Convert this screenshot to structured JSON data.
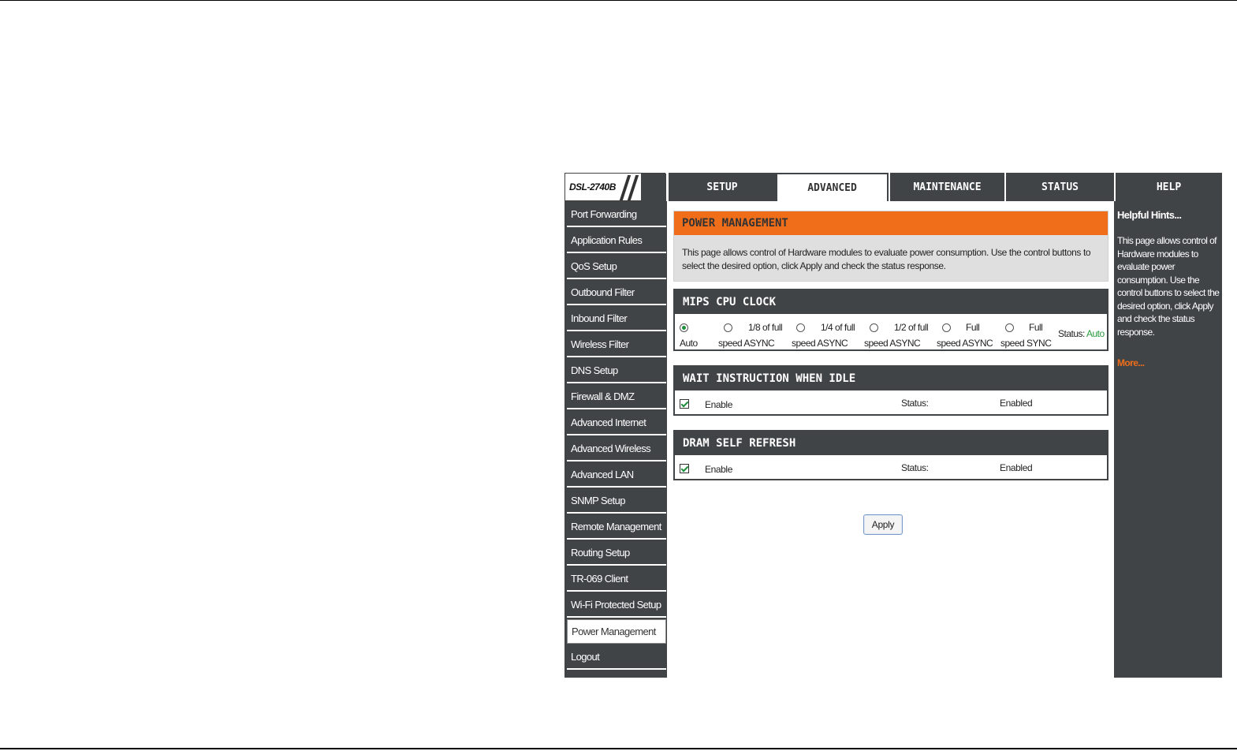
{
  "header": {
    "logo": "DSL-2740B",
    "tabs": [
      {
        "label": "SETUP",
        "active": false
      },
      {
        "label": "ADVANCED",
        "active": true
      },
      {
        "label": "MAINTENANCE",
        "active": false
      },
      {
        "label": "STATUS",
        "active": false
      },
      {
        "label": "HELP",
        "active": false
      }
    ]
  },
  "sidebar": {
    "items": [
      "Port Forwarding",
      "Application Rules",
      "QoS Setup",
      "Outbound Filter",
      "Inbound Filter",
      "Wireless Filter",
      "DNS Setup",
      "Firewall & DMZ",
      "Advanced Internet",
      "Advanced Wireless",
      "Advanced LAN",
      "SNMP Setup",
      "Remote Management",
      "Routing Setup",
      "TR-069 Client",
      "Wi-Fi Protected Setup",
      "Power Management",
      "Logout"
    ],
    "active": "Power Management"
  },
  "power_management": {
    "title": "POWER MANAGEMENT",
    "description": "This page allows control of Hardware modules to evaluate power consumption. Use the control buttons to select the desired option, click Apply and check the status response."
  },
  "mips_cpu_clock": {
    "title": "MIPS CPU CLOCK",
    "options": [
      {
        "line1": "",
        "line2": "Auto",
        "selected": true
      },
      {
        "line1": "1/8 of full",
        "line2": "speed ASYNC",
        "selected": false
      },
      {
        "line1": "1/4 of full",
        "line2": "speed ASYNC",
        "selected": false
      },
      {
        "line1": "1/2 of full",
        "line2": "speed ASYNC",
        "selected": false
      },
      {
        "line1": "Full",
        "line2": "speed ASYNC",
        "selected": false
      },
      {
        "line1": "Full",
        "line2": "speed SYNC",
        "selected": false
      }
    ],
    "status_label": "Status:",
    "status_value": "Auto"
  },
  "wait_instruction": {
    "title": "WAIT INSTRUCTION WHEN IDLE",
    "enable_label": "Enable",
    "checked": true,
    "status_label": "Status:",
    "status_value": "Enabled"
  },
  "dram_self_refresh": {
    "title": "DRAM SELF REFRESH",
    "enable_label": "Enable",
    "checked": true,
    "status_label": "Status:",
    "status_value": "Enabled"
  },
  "apply_label": "Apply",
  "hints": {
    "title": "Helpful Hints...",
    "body": "This page allows control of Hardware modules to evaluate power consumption. Use the control buttons to select the desired option, click Apply and check the status response.",
    "more": "More..."
  },
  "colors": {
    "orange": "#f06e1a",
    "dark_gray": "#404447",
    "status_green": "#2a9a3e"
  }
}
